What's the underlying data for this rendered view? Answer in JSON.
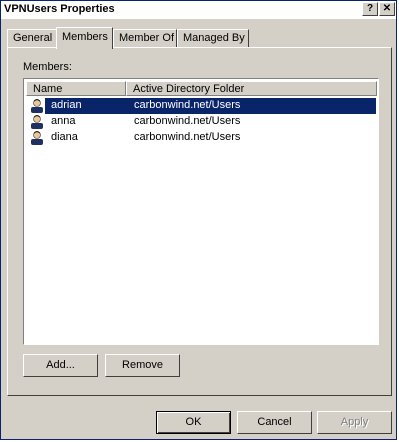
{
  "window": {
    "title": "VPNUsers Properties"
  },
  "titlebar": {
    "help_glyph": "?",
    "close_glyph": "✕"
  },
  "tabs": [
    {
      "label": "General",
      "active": false
    },
    {
      "label": "Members",
      "active": true
    },
    {
      "label": "Member Of",
      "active": false
    },
    {
      "label": "Managed By",
      "active": false
    }
  ],
  "members": {
    "label": "Members:",
    "columns": [
      "Name",
      "Active Directory Folder"
    ],
    "rows": [
      {
        "name": "adrian",
        "folder": "carbonwind.net/Users",
        "selected": true
      },
      {
        "name": "anna",
        "folder": "carbonwind.net/Users",
        "selected": false
      },
      {
        "name": "diana",
        "folder": "carbonwind.net/Users",
        "selected": false
      }
    ],
    "row_icon": "user-icon"
  },
  "buttons": {
    "add": "Add...",
    "remove": "Remove",
    "ok": "OK",
    "cancel": "Cancel",
    "apply": "Apply"
  },
  "colors": {
    "selection": "#0a246a",
    "face": "#d4d0c8"
  }
}
